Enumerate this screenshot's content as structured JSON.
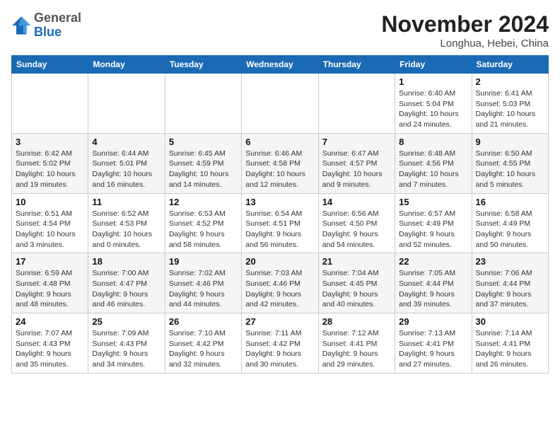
{
  "header": {
    "logo_general": "General",
    "logo_blue": "Blue",
    "month_title": "November 2024",
    "location": "Longhua, Hebei, China"
  },
  "days_of_week": [
    "Sunday",
    "Monday",
    "Tuesday",
    "Wednesday",
    "Thursday",
    "Friday",
    "Saturday"
  ],
  "weeks": [
    [
      {
        "day": "",
        "info": ""
      },
      {
        "day": "",
        "info": ""
      },
      {
        "day": "",
        "info": ""
      },
      {
        "day": "",
        "info": ""
      },
      {
        "day": "",
        "info": ""
      },
      {
        "day": "1",
        "info": "Sunrise: 6:40 AM\nSunset: 5:04 PM\nDaylight: 10 hours and 24 minutes."
      },
      {
        "day": "2",
        "info": "Sunrise: 6:41 AM\nSunset: 5:03 PM\nDaylight: 10 hours and 21 minutes."
      }
    ],
    [
      {
        "day": "3",
        "info": "Sunrise: 6:42 AM\nSunset: 5:02 PM\nDaylight: 10 hours and 19 minutes."
      },
      {
        "day": "4",
        "info": "Sunrise: 6:44 AM\nSunset: 5:01 PM\nDaylight: 10 hours and 16 minutes."
      },
      {
        "day": "5",
        "info": "Sunrise: 6:45 AM\nSunset: 4:59 PM\nDaylight: 10 hours and 14 minutes."
      },
      {
        "day": "6",
        "info": "Sunrise: 6:46 AM\nSunset: 4:58 PM\nDaylight: 10 hours and 12 minutes."
      },
      {
        "day": "7",
        "info": "Sunrise: 6:47 AM\nSunset: 4:57 PM\nDaylight: 10 hours and 9 minutes."
      },
      {
        "day": "8",
        "info": "Sunrise: 6:48 AM\nSunset: 4:56 PM\nDaylight: 10 hours and 7 minutes."
      },
      {
        "day": "9",
        "info": "Sunrise: 6:50 AM\nSunset: 4:55 PM\nDaylight: 10 hours and 5 minutes."
      }
    ],
    [
      {
        "day": "10",
        "info": "Sunrise: 6:51 AM\nSunset: 4:54 PM\nDaylight: 10 hours and 3 minutes."
      },
      {
        "day": "11",
        "info": "Sunrise: 6:52 AM\nSunset: 4:53 PM\nDaylight: 10 hours and 0 minutes."
      },
      {
        "day": "12",
        "info": "Sunrise: 6:53 AM\nSunset: 4:52 PM\nDaylight: 9 hours and 58 minutes."
      },
      {
        "day": "13",
        "info": "Sunrise: 6:54 AM\nSunset: 4:51 PM\nDaylight: 9 hours and 56 minutes."
      },
      {
        "day": "14",
        "info": "Sunrise: 6:56 AM\nSunset: 4:50 PM\nDaylight: 9 hours and 54 minutes."
      },
      {
        "day": "15",
        "info": "Sunrise: 6:57 AM\nSunset: 4:49 PM\nDaylight: 9 hours and 52 minutes."
      },
      {
        "day": "16",
        "info": "Sunrise: 6:58 AM\nSunset: 4:49 PM\nDaylight: 9 hours and 50 minutes."
      }
    ],
    [
      {
        "day": "17",
        "info": "Sunrise: 6:59 AM\nSunset: 4:48 PM\nDaylight: 9 hours and 48 minutes."
      },
      {
        "day": "18",
        "info": "Sunrise: 7:00 AM\nSunset: 4:47 PM\nDaylight: 9 hours and 46 minutes."
      },
      {
        "day": "19",
        "info": "Sunrise: 7:02 AM\nSunset: 4:46 PM\nDaylight: 9 hours and 44 minutes."
      },
      {
        "day": "20",
        "info": "Sunrise: 7:03 AM\nSunset: 4:46 PM\nDaylight: 9 hours and 42 minutes."
      },
      {
        "day": "21",
        "info": "Sunrise: 7:04 AM\nSunset: 4:45 PM\nDaylight: 9 hours and 40 minutes."
      },
      {
        "day": "22",
        "info": "Sunrise: 7:05 AM\nSunset: 4:44 PM\nDaylight: 9 hours and 39 minutes."
      },
      {
        "day": "23",
        "info": "Sunrise: 7:06 AM\nSunset: 4:44 PM\nDaylight: 9 hours and 37 minutes."
      }
    ],
    [
      {
        "day": "24",
        "info": "Sunrise: 7:07 AM\nSunset: 4:43 PM\nDaylight: 9 hours and 35 minutes."
      },
      {
        "day": "25",
        "info": "Sunrise: 7:09 AM\nSunset: 4:43 PM\nDaylight: 9 hours and 34 minutes."
      },
      {
        "day": "26",
        "info": "Sunrise: 7:10 AM\nSunset: 4:42 PM\nDaylight: 9 hours and 32 minutes."
      },
      {
        "day": "27",
        "info": "Sunrise: 7:11 AM\nSunset: 4:42 PM\nDaylight: 9 hours and 30 minutes."
      },
      {
        "day": "28",
        "info": "Sunrise: 7:12 AM\nSunset: 4:41 PM\nDaylight: 9 hours and 29 minutes."
      },
      {
        "day": "29",
        "info": "Sunrise: 7:13 AM\nSunset: 4:41 PM\nDaylight: 9 hours and 27 minutes."
      },
      {
        "day": "30",
        "info": "Sunrise: 7:14 AM\nSunset: 4:41 PM\nDaylight: 9 hours and 26 minutes."
      }
    ]
  ]
}
